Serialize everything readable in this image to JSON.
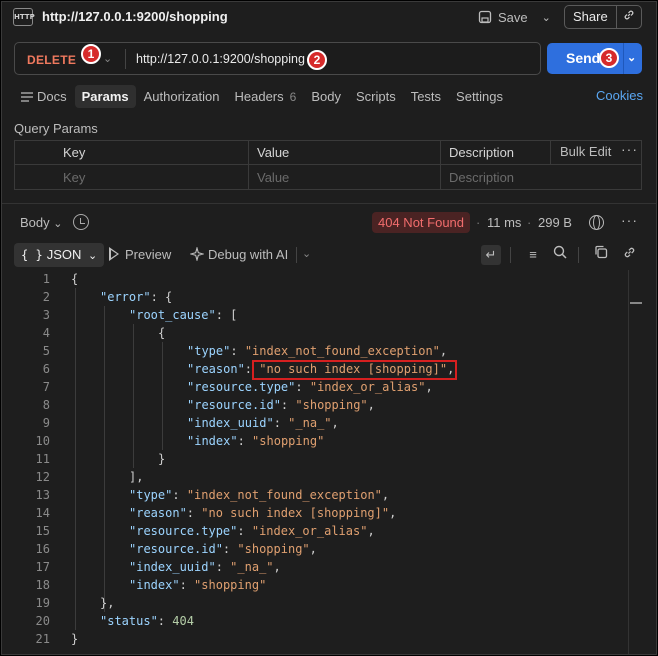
{
  "header": {
    "icon_text": "HTTP",
    "title": "http://127.0.0.1:9200/shopping",
    "save_label": "Save",
    "share_label": "Share"
  },
  "request": {
    "method": "DELETE",
    "url": "http://127.0.0.1:9200/shopping",
    "send_label": "Send",
    "badges": [
      "1",
      "2",
      "3"
    ]
  },
  "tabs": [
    {
      "label": "Docs"
    },
    {
      "label": "Params",
      "active": true
    },
    {
      "label": "Authorization"
    },
    {
      "label": "Headers",
      "count": "6"
    },
    {
      "label": "Body"
    },
    {
      "label": "Scripts"
    },
    {
      "label": "Tests"
    },
    {
      "label": "Settings"
    }
  ],
  "cookies_label": "Cookies",
  "query_params": {
    "title": "Query Params",
    "columns": [
      "Key",
      "Value",
      "Description"
    ],
    "bulk_edit": "Bulk Edit",
    "placeholders": [
      "Key",
      "Value",
      "Description"
    ]
  },
  "response": {
    "body_label": "Body",
    "status": "404 Not Found",
    "time": "11 ms",
    "size": "299 B",
    "format": "JSON",
    "preview_label": "Preview",
    "debug_label": "Debug with AI",
    "lines": [
      "{",
      "    \"error\": {",
      "        \"root_cause\": [",
      "            {",
      "                \"type\": \"index_not_found_exception\",",
      "                \"reason\": \"no such index [shopping]\",",
      "                \"resource.type\": \"index_or_alias\",",
      "                \"resource.id\": \"shopping\",",
      "                \"index_uuid\": \"_na_\",",
      "                \"index\": \"shopping\"",
      "            }",
      "        ],",
      "        \"type\": \"index_not_found_exception\",",
      "        \"reason\": \"no such index [shopping]\",",
      "        \"resource.type\": \"index_or_alias\",",
      "        \"resource.id\": \"shopping\",",
      "        \"index_uuid\": \"_na_\",",
      "        \"index\": \"shopping\"",
      "    },",
      "    \"status\": 404",
      "}"
    ]
  },
  "colors": {
    "method": "#f0795e",
    "send": "#2e6fde",
    "status_text": "#f26d6d",
    "json_key": "#9cd4ff",
    "json_string": "#e0a070",
    "highlight_box": "#d62020"
  }
}
